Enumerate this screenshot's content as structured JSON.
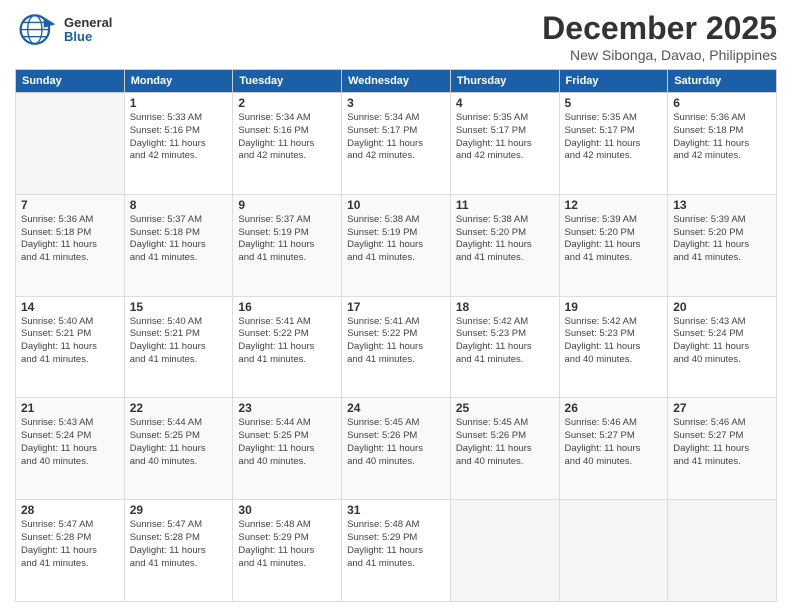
{
  "logo": {
    "general": "General",
    "blue": "Blue"
  },
  "title": "December 2025",
  "subtitle": "New Sibonga, Davao, Philippines",
  "headers": [
    "Sunday",
    "Monday",
    "Tuesday",
    "Wednesday",
    "Thursday",
    "Friday",
    "Saturday"
  ],
  "weeks": [
    [
      {
        "day": "",
        "info": ""
      },
      {
        "day": "1",
        "info": "Sunrise: 5:33 AM\nSunset: 5:16 PM\nDaylight: 11 hours\nand 42 minutes."
      },
      {
        "day": "2",
        "info": "Sunrise: 5:34 AM\nSunset: 5:16 PM\nDaylight: 11 hours\nand 42 minutes."
      },
      {
        "day": "3",
        "info": "Sunrise: 5:34 AM\nSunset: 5:17 PM\nDaylight: 11 hours\nand 42 minutes."
      },
      {
        "day": "4",
        "info": "Sunrise: 5:35 AM\nSunset: 5:17 PM\nDaylight: 11 hours\nand 42 minutes."
      },
      {
        "day": "5",
        "info": "Sunrise: 5:35 AM\nSunset: 5:17 PM\nDaylight: 11 hours\nand 42 minutes."
      },
      {
        "day": "6",
        "info": "Sunrise: 5:36 AM\nSunset: 5:18 PM\nDaylight: 11 hours\nand 42 minutes."
      }
    ],
    [
      {
        "day": "7",
        "info": "Sunrise: 5:36 AM\nSunset: 5:18 PM\nDaylight: 11 hours\nand 41 minutes."
      },
      {
        "day": "8",
        "info": "Sunrise: 5:37 AM\nSunset: 5:18 PM\nDaylight: 11 hours\nand 41 minutes."
      },
      {
        "day": "9",
        "info": "Sunrise: 5:37 AM\nSunset: 5:19 PM\nDaylight: 11 hours\nand 41 minutes."
      },
      {
        "day": "10",
        "info": "Sunrise: 5:38 AM\nSunset: 5:19 PM\nDaylight: 11 hours\nand 41 minutes."
      },
      {
        "day": "11",
        "info": "Sunrise: 5:38 AM\nSunset: 5:20 PM\nDaylight: 11 hours\nand 41 minutes."
      },
      {
        "day": "12",
        "info": "Sunrise: 5:39 AM\nSunset: 5:20 PM\nDaylight: 11 hours\nand 41 minutes."
      },
      {
        "day": "13",
        "info": "Sunrise: 5:39 AM\nSunset: 5:20 PM\nDaylight: 11 hours\nand 41 minutes."
      }
    ],
    [
      {
        "day": "14",
        "info": "Sunrise: 5:40 AM\nSunset: 5:21 PM\nDaylight: 11 hours\nand 41 minutes."
      },
      {
        "day": "15",
        "info": "Sunrise: 5:40 AM\nSunset: 5:21 PM\nDaylight: 11 hours\nand 41 minutes."
      },
      {
        "day": "16",
        "info": "Sunrise: 5:41 AM\nSunset: 5:22 PM\nDaylight: 11 hours\nand 41 minutes."
      },
      {
        "day": "17",
        "info": "Sunrise: 5:41 AM\nSunset: 5:22 PM\nDaylight: 11 hours\nand 41 minutes."
      },
      {
        "day": "18",
        "info": "Sunrise: 5:42 AM\nSunset: 5:23 PM\nDaylight: 11 hours\nand 41 minutes."
      },
      {
        "day": "19",
        "info": "Sunrise: 5:42 AM\nSunset: 5:23 PM\nDaylight: 11 hours\nand 40 minutes."
      },
      {
        "day": "20",
        "info": "Sunrise: 5:43 AM\nSunset: 5:24 PM\nDaylight: 11 hours\nand 40 minutes."
      }
    ],
    [
      {
        "day": "21",
        "info": "Sunrise: 5:43 AM\nSunset: 5:24 PM\nDaylight: 11 hours\nand 40 minutes."
      },
      {
        "day": "22",
        "info": "Sunrise: 5:44 AM\nSunset: 5:25 PM\nDaylight: 11 hours\nand 40 minutes."
      },
      {
        "day": "23",
        "info": "Sunrise: 5:44 AM\nSunset: 5:25 PM\nDaylight: 11 hours\nand 40 minutes."
      },
      {
        "day": "24",
        "info": "Sunrise: 5:45 AM\nSunset: 5:26 PM\nDaylight: 11 hours\nand 40 minutes."
      },
      {
        "day": "25",
        "info": "Sunrise: 5:45 AM\nSunset: 5:26 PM\nDaylight: 11 hours\nand 40 minutes."
      },
      {
        "day": "26",
        "info": "Sunrise: 5:46 AM\nSunset: 5:27 PM\nDaylight: 11 hours\nand 40 minutes."
      },
      {
        "day": "27",
        "info": "Sunrise: 5:46 AM\nSunset: 5:27 PM\nDaylight: 11 hours\nand 41 minutes."
      }
    ],
    [
      {
        "day": "28",
        "info": "Sunrise: 5:47 AM\nSunset: 5:28 PM\nDaylight: 11 hours\nand 41 minutes."
      },
      {
        "day": "29",
        "info": "Sunrise: 5:47 AM\nSunset: 5:28 PM\nDaylight: 11 hours\nand 41 minutes."
      },
      {
        "day": "30",
        "info": "Sunrise: 5:48 AM\nSunset: 5:29 PM\nDaylight: 11 hours\nand 41 minutes."
      },
      {
        "day": "31",
        "info": "Sunrise: 5:48 AM\nSunset: 5:29 PM\nDaylight: 11 hours\nand 41 minutes."
      },
      {
        "day": "",
        "info": ""
      },
      {
        "day": "",
        "info": ""
      },
      {
        "day": "",
        "info": ""
      }
    ]
  ]
}
